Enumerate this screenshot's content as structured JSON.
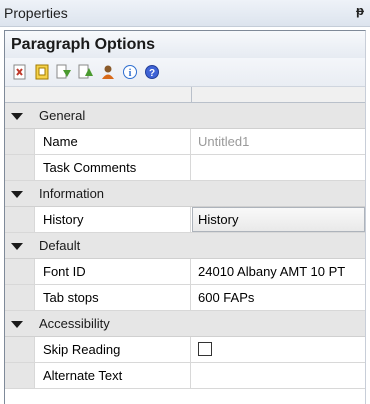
{
  "window": {
    "title": "Properties",
    "pin_glyph": "ᵽ"
  },
  "panel": {
    "heading": "Paragraph Options"
  },
  "toolbar": {
    "buttons": [
      {
        "name": "delete-icon",
        "color": "#c0392b"
      },
      {
        "name": "page-icon",
        "color": "#e0a800"
      },
      {
        "name": "move-down-icon",
        "color": "#4a9a2f"
      },
      {
        "name": "move-up-icon",
        "color": "#4a9a2f"
      },
      {
        "name": "person-icon",
        "color": "#d86a1a"
      },
      {
        "name": "info-icon",
        "color": "#2f6fd0"
      },
      {
        "name": "help-icon",
        "color": "#2f4fc0"
      }
    ]
  },
  "categories": [
    {
      "label": "General",
      "properties": [
        {
          "name": "Name",
          "value": "Untitled1"
        },
        {
          "name": "Task Comments",
          "value": ""
        }
      ]
    },
    {
      "label": "Information",
      "properties": [
        {
          "name": "History",
          "value": "History"
        }
      ]
    },
    {
      "label": "Default",
      "properties": [
        {
          "name": "Font ID",
          "value": "24010 Albany AMT 10 PT"
        },
        {
          "name": "Tab stops",
          "value": "600 FAPs"
        }
      ]
    },
    {
      "label": "Accessibility",
      "properties": [
        {
          "name": "Skip Reading",
          "checked": false
        },
        {
          "name": "Alternate Text",
          "value": ""
        }
      ]
    }
  ]
}
